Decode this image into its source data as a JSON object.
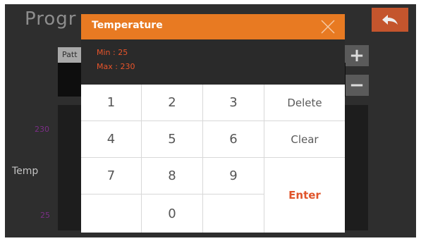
{
  "screen": {
    "title": "Progr",
    "pattern_tab": "Patt",
    "add_symbol": "+",
    "minus_symbol": "−",
    "axis_max": "230",
    "axis_min": "25",
    "temp_label": "Temp"
  },
  "dialog": {
    "title": "Temperature",
    "min_text": "Min :  25",
    "max_text": "Max : 230",
    "keys": {
      "k1": "1",
      "k2": "2",
      "k3": "3",
      "k4": "4",
      "k5": "5",
      "k6": "6",
      "k7": "7",
      "k8": "8",
      "k9": "9",
      "k0": "0",
      "delete": "Delete",
      "clear": "Clear",
      "enter": "Enter"
    }
  },
  "colors": {
    "header": "#e87a22",
    "accent_text": "#e8542a",
    "back_button": "#c4552d",
    "axis_labels": "#7b2e86"
  },
  "icons": {
    "back": "back-arrow-icon",
    "close": "close-icon"
  }
}
